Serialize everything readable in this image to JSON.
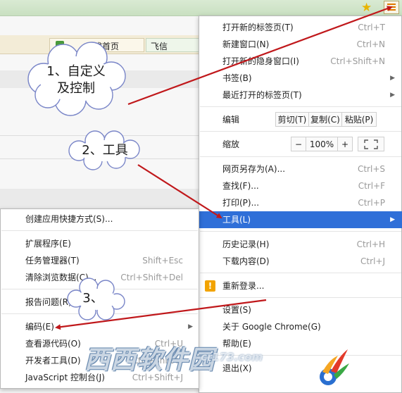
{
  "main_menu": {
    "new_tab": {
      "label": "打开新的标签页(T)",
      "shortcut": "Ctrl+T"
    },
    "new_window": {
      "label": "新建窗口(N)",
      "shortcut": "Ctrl+N"
    },
    "incognito": {
      "label": "打开新的隐身窗口(I)",
      "shortcut": "Ctrl+Shift+N"
    },
    "bookmarks": {
      "label": "书签(B)"
    },
    "recent_tabs": {
      "label": "最近打开的标签页(T)"
    },
    "edit": {
      "label": "编辑",
      "cut": "剪切(T)",
      "copy": "复制(C)",
      "paste": "粘贴(P)"
    },
    "zoom": {
      "label": "缩放",
      "minus": "−",
      "value": "100%",
      "plus": "+"
    },
    "save_as": {
      "label": "网页另存为(A)...",
      "shortcut": "Ctrl+S"
    },
    "find": {
      "label": "查找(F)...",
      "shortcut": "Ctrl+F"
    },
    "print": {
      "label": "打印(P)...",
      "shortcut": "Ctrl+P"
    },
    "tools": {
      "label": "工具(L)"
    },
    "history": {
      "label": "历史记录(H)",
      "shortcut": "Ctrl+H"
    },
    "downloads": {
      "label": "下载内容(D)",
      "shortcut": "Ctrl+J"
    },
    "relogin": {
      "label": "重新登录...",
      "icon": "warning-icon"
    },
    "settings": {
      "label": "设置(S)"
    },
    "about": {
      "label": "关于 Google Chrome(G)"
    },
    "help": {
      "label": "帮助(E)"
    },
    "exit": {
      "label": "退出(X)"
    }
  },
  "tools_submenu": {
    "create_shortcut": {
      "label": "创建应用快捷方式(S)..."
    },
    "extensions": {
      "label": "扩展程序(E)"
    },
    "task_manager": {
      "label": "任务管理器(T)",
      "shortcut": "Shift+Esc"
    },
    "clear_data": {
      "label": "清除浏览数据(C)...",
      "shortcut": "Ctrl+Shift+Del"
    },
    "report_issue": {
      "label": "报告问题(R)..."
    },
    "encoding": {
      "label": "编码(E)"
    },
    "view_source": {
      "label": "查看源代码(O)",
      "shortcut": "Ctrl+U"
    },
    "dev_tools": {
      "label": "开发者工具(D)",
      "shortcut": "Ctrl+Shift+I"
    },
    "js_console": {
      "label": "JavaScript 控制台(J)",
      "shortcut": "Ctrl+Shift+J"
    }
  },
  "background": {
    "bookmark_1": "生成首页",
    "bookmark_2": "飞信"
  },
  "annotations": {
    "step1": "1、自定义\n及控制",
    "step2": "2、工具",
    "step3": "3、"
  },
  "watermark": {
    "text": "西西软件园",
    "url": "cr173.com"
  },
  "colors": {
    "highlight": "#2f6fd8",
    "arrow": "#c0181b",
    "cloud_fill": "#ffffff",
    "cloud_stroke": "#7a86c8"
  }
}
